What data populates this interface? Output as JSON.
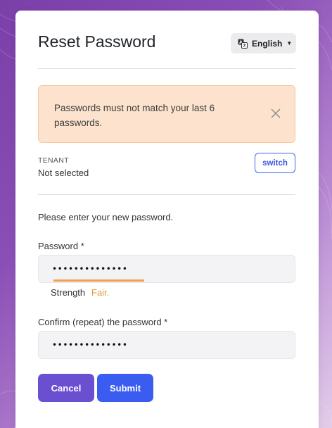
{
  "header": {
    "title": "Reset Password",
    "language": "English"
  },
  "alert": {
    "message": "Passwords must not match your last 6 passwords."
  },
  "tenant": {
    "label": "TENANT",
    "value": "Not selected",
    "switch_label": "switch"
  },
  "form": {
    "intro": "Please enter your new password.",
    "password_label": "Password *",
    "password_value": "••••••••••••••",
    "strength_label": "Strength",
    "strength_value": "Fair.",
    "strength_fraction": 0.5,
    "confirm_label": "Confirm (repeat) the password *",
    "confirm_value": "••••••••••••••"
  },
  "actions": {
    "cancel_label": "Cancel",
    "submit_label": "Submit"
  },
  "colors": {
    "primary": "#3a5cf0",
    "cancel": "#6a4fd0",
    "warning_bg": "#fde3cd",
    "strength": "#f2a04c"
  }
}
